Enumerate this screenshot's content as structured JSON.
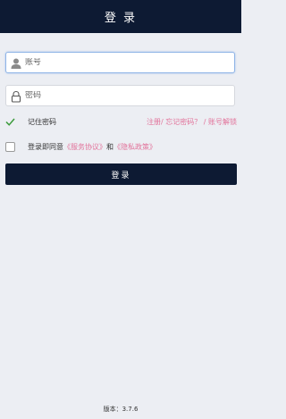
{
  "header": {
    "title": "登 录"
  },
  "form": {
    "account_placeholder": "账号",
    "account_value": "",
    "password_placeholder": "密码",
    "password_value": ""
  },
  "remember": {
    "label": "记住密码",
    "checked": true
  },
  "links": {
    "register": "注册/",
    "forgot": "忘记密码？",
    "separator": "/",
    "unlock": "账号解锁"
  },
  "agreement": {
    "checked": false,
    "prefix": "登录即同意",
    "service": "《服务协议》",
    "and": "和",
    "privacy": "《隐私政策》"
  },
  "login_button": {
    "label": "登录"
  },
  "footer": {
    "version": "版本：3.7.6"
  },
  "colors": {
    "primary": "#0d1a33",
    "link": "#e2729a",
    "background": "#eceef3",
    "check": "#3a9a3a"
  },
  "icons": {
    "account": "user-icon",
    "password": "lock-icon",
    "remember": "checkmark-icon"
  }
}
